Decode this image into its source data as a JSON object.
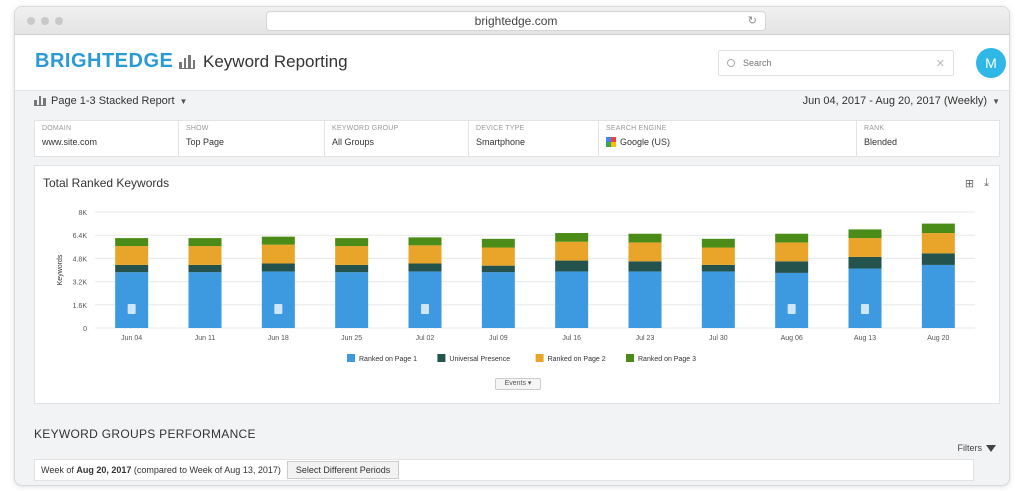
{
  "browser": {
    "url": "brightedge.com"
  },
  "header": {
    "brand": "BRIGHTEDGE",
    "title": "Keyword Reporting",
    "search_placeholder": "Search",
    "avatar_initial": "M"
  },
  "report": {
    "selector": "Page 1-3 Stacked Report",
    "date_range": "Jun 04, 2017 - Aug 20, 2017 (Weekly)"
  },
  "filters": [
    {
      "label": "DOMAIN",
      "value": "www.site.com"
    },
    {
      "label": "SHOW",
      "value": "Top Page"
    },
    {
      "label": "KEYWORD GROUP",
      "value": "All Groups"
    },
    {
      "label": "DEVICE TYPE",
      "value": "Smartphone"
    },
    {
      "label": "SEARCH ENGINE",
      "value": "Google (US)"
    },
    {
      "label": "RANK",
      "value": "Blended"
    }
  ],
  "card": {
    "title": "Total Ranked Keywords",
    "events_label": "Events"
  },
  "chart_data": {
    "type": "bar",
    "stacked": true,
    "ylabel": "Keywords",
    "y_ticks": [
      "0",
      "1.6K",
      "3.2K",
      "4.8K",
      "6.4K",
      "8K"
    ],
    "ylim": [
      0,
      8000
    ],
    "grid": true,
    "legend_position": "bottom",
    "categories": [
      "Jun 04",
      "Jun 11",
      "Jun 18",
      "Jun 25",
      "Jul 02",
      "Jul 09",
      "Jul 16",
      "Jul 23",
      "Jul 30",
      "Aug 06",
      "Aug 13",
      "Aug 20"
    ],
    "series": [
      {
        "name": "Ranked on Page 1",
        "color": "#3d9ae0",
        "values": [
          3850,
          3850,
          3900,
          3850,
          3900,
          3850,
          3900,
          3900,
          3900,
          3800,
          4100,
          4350
        ]
      },
      {
        "name": "Universal Presence",
        "color": "#24524c",
        "values": [
          500,
          500,
          550,
          500,
          550,
          450,
          750,
          700,
          450,
          800,
          800,
          800
        ]
      },
      {
        "name": "Ranked on Page 2",
        "color": "#e8a52a",
        "values": [
          1300,
          1300,
          1300,
          1300,
          1250,
          1250,
          1300,
          1300,
          1200,
          1300,
          1300,
          1400
        ]
      },
      {
        "name": "Ranked on Page 3",
        "color": "#4a8c17",
        "values": [
          550,
          550,
          550,
          550,
          550,
          600,
          600,
          600,
          600,
          600,
          600,
          650
        ]
      }
    ],
    "annotation_icon_weeks": [
      "Jun 04",
      "Jun 18",
      "Jul 02",
      "Aug 06",
      "Aug 13"
    ]
  },
  "keyword_groups": {
    "title": "KEYWORD GROUPS PERFORMANCE",
    "filters_label": "Filters",
    "week_prefix": "Week of",
    "week_date": "Aug 20, 2017",
    "week_suffix": "(compared to Week of Aug 13, 2017)",
    "select_button": "Select Different Periods"
  }
}
